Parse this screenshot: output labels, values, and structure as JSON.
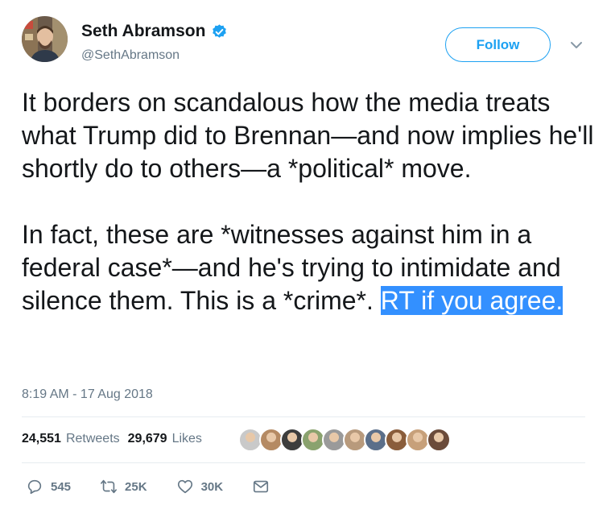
{
  "author": {
    "display_name": "Seth Abramson",
    "handle": "@SethAbramson",
    "verified": true,
    "avatar_icon": "person-avatar"
  },
  "header": {
    "follow_label": "Follow",
    "menu_icon": "chevron-down-icon"
  },
  "tweet": {
    "paragraph1": "It borders on scandalous how the media treats what Trump did to Brennan—and now implies he'll shortly do to others—a *political* move.",
    "paragraph2_plain": "In fact, these are *witnesses against him in a federal case*—and he's trying to intimidate and silence them. This is a *crime*. ",
    "paragraph2_highlight": "RT if you agree.",
    "timestamp": "8:19 AM - 17 Aug 2018"
  },
  "stats": {
    "retweets_count": "24,551",
    "retweets_label": "Retweets",
    "likes_count": "29,679",
    "likes_label": "Likes"
  },
  "likers": [
    {
      "name": "liker-avatar",
      "color": "#c9c9c9"
    },
    {
      "name": "liker-avatar",
      "color": "#b58a63"
    },
    {
      "name": "liker-avatar",
      "color": "#3d3d3d"
    },
    {
      "name": "liker-avatar",
      "color": "#8aa26e"
    },
    {
      "name": "liker-avatar",
      "color": "#9a9a9a"
    },
    {
      "name": "liker-avatar",
      "color": "#b89a7c"
    },
    {
      "name": "liker-avatar",
      "color": "#5b6f8a"
    },
    {
      "name": "liker-avatar",
      "color": "#8a5d3b"
    },
    {
      "name": "liker-avatar",
      "color": "#c7a07a"
    },
    {
      "name": "liker-avatar",
      "color": "#6b4b3a"
    }
  ],
  "actions": {
    "reply_count": "545",
    "retweet_count": "25K",
    "like_count": "30K"
  },
  "colors": {
    "accent": "#1da1f2",
    "highlight": "#3390ff",
    "secondary_text": "#657786"
  }
}
